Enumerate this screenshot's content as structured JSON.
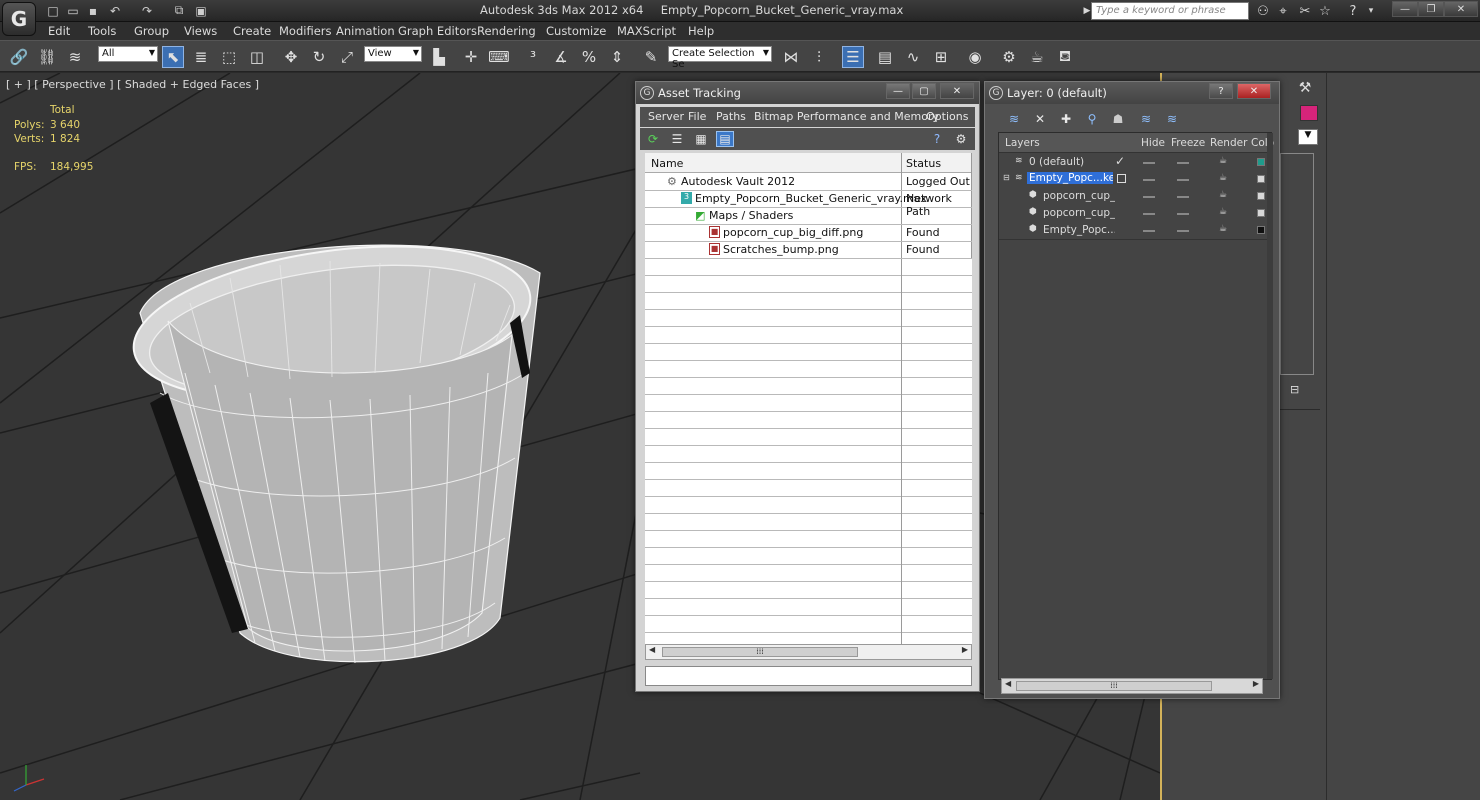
{
  "app": {
    "title": "Autodesk 3ds Max  2012 x64",
    "file": "Empty_Popcorn_Bucket_Generic_vray.max",
    "search_placeholder": "Type a keyword or phrase",
    "logo_letter": "G"
  },
  "menu": [
    "Edit",
    "Tools",
    "Group",
    "Views",
    "Create",
    "Modifiers",
    "Animation",
    "Graph Editors",
    "Rendering",
    "Customize",
    "MAXScript",
    "Help"
  ],
  "toolbar": {
    "filter_value": "All",
    "refcoord_value": "View",
    "selection_set_placeholder": "Create Selection Se"
  },
  "viewport": {
    "label": "[ + ] [ Perspective ] [ Shaded + Edged Faces ]",
    "stats_header": "Total",
    "polys_label": "Polys:",
    "polys_value": "3 640",
    "verts_label": "Verts:",
    "verts_value": "1 824",
    "fps_label": "FPS:",
    "fps_value": "184,995"
  },
  "asset_tracking": {
    "title": "Asset Tracking",
    "menu": [
      "Server",
      "File",
      "Paths",
      "Bitmap Performance and Memory",
      "Options"
    ],
    "columns": [
      "Name",
      "Status"
    ],
    "rows": [
      {
        "name": "Autodesk Vault 2012",
        "status": "Logged Out ..."
      },
      {
        "name": "Empty_Popcorn_Bucket_Generic_vray.max",
        "status": "Network Path"
      },
      {
        "name": "Maps / Shaders",
        "status": ""
      },
      {
        "name": "popcorn_cup_big_diff.png",
        "status": "Found"
      },
      {
        "name": "Scratches_bump.png",
        "status": "Found"
      }
    ]
  },
  "layer_dialog": {
    "title": "Layer: 0 (default)",
    "columns": [
      "Layers",
      "Hide",
      "Freeze",
      "Render",
      "Colo"
    ],
    "rows": [
      {
        "name": "0 (default)",
        "color": "#1f9c8c"
      },
      {
        "name": "Empty_Popc...ket_",
        "color": "#d8d8d8"
      },
      {
        "name": "popcorn_cup_big",
        "color": "#d8d8d8"
      },
      {
        "name": "popcorn_cup_big",
        "color": "#d8d8d8"
      },
      {
        "name": "Empty_Popc...ke",
        "color": "#111111"
      }
    ]
  },
  "colors": {
    "accent": "#3b78c8",
    "stats": "#e6d46a",
    "viewport_bg": "#353535",
    "magenta_swatch": "#d6247a"
  }
}
